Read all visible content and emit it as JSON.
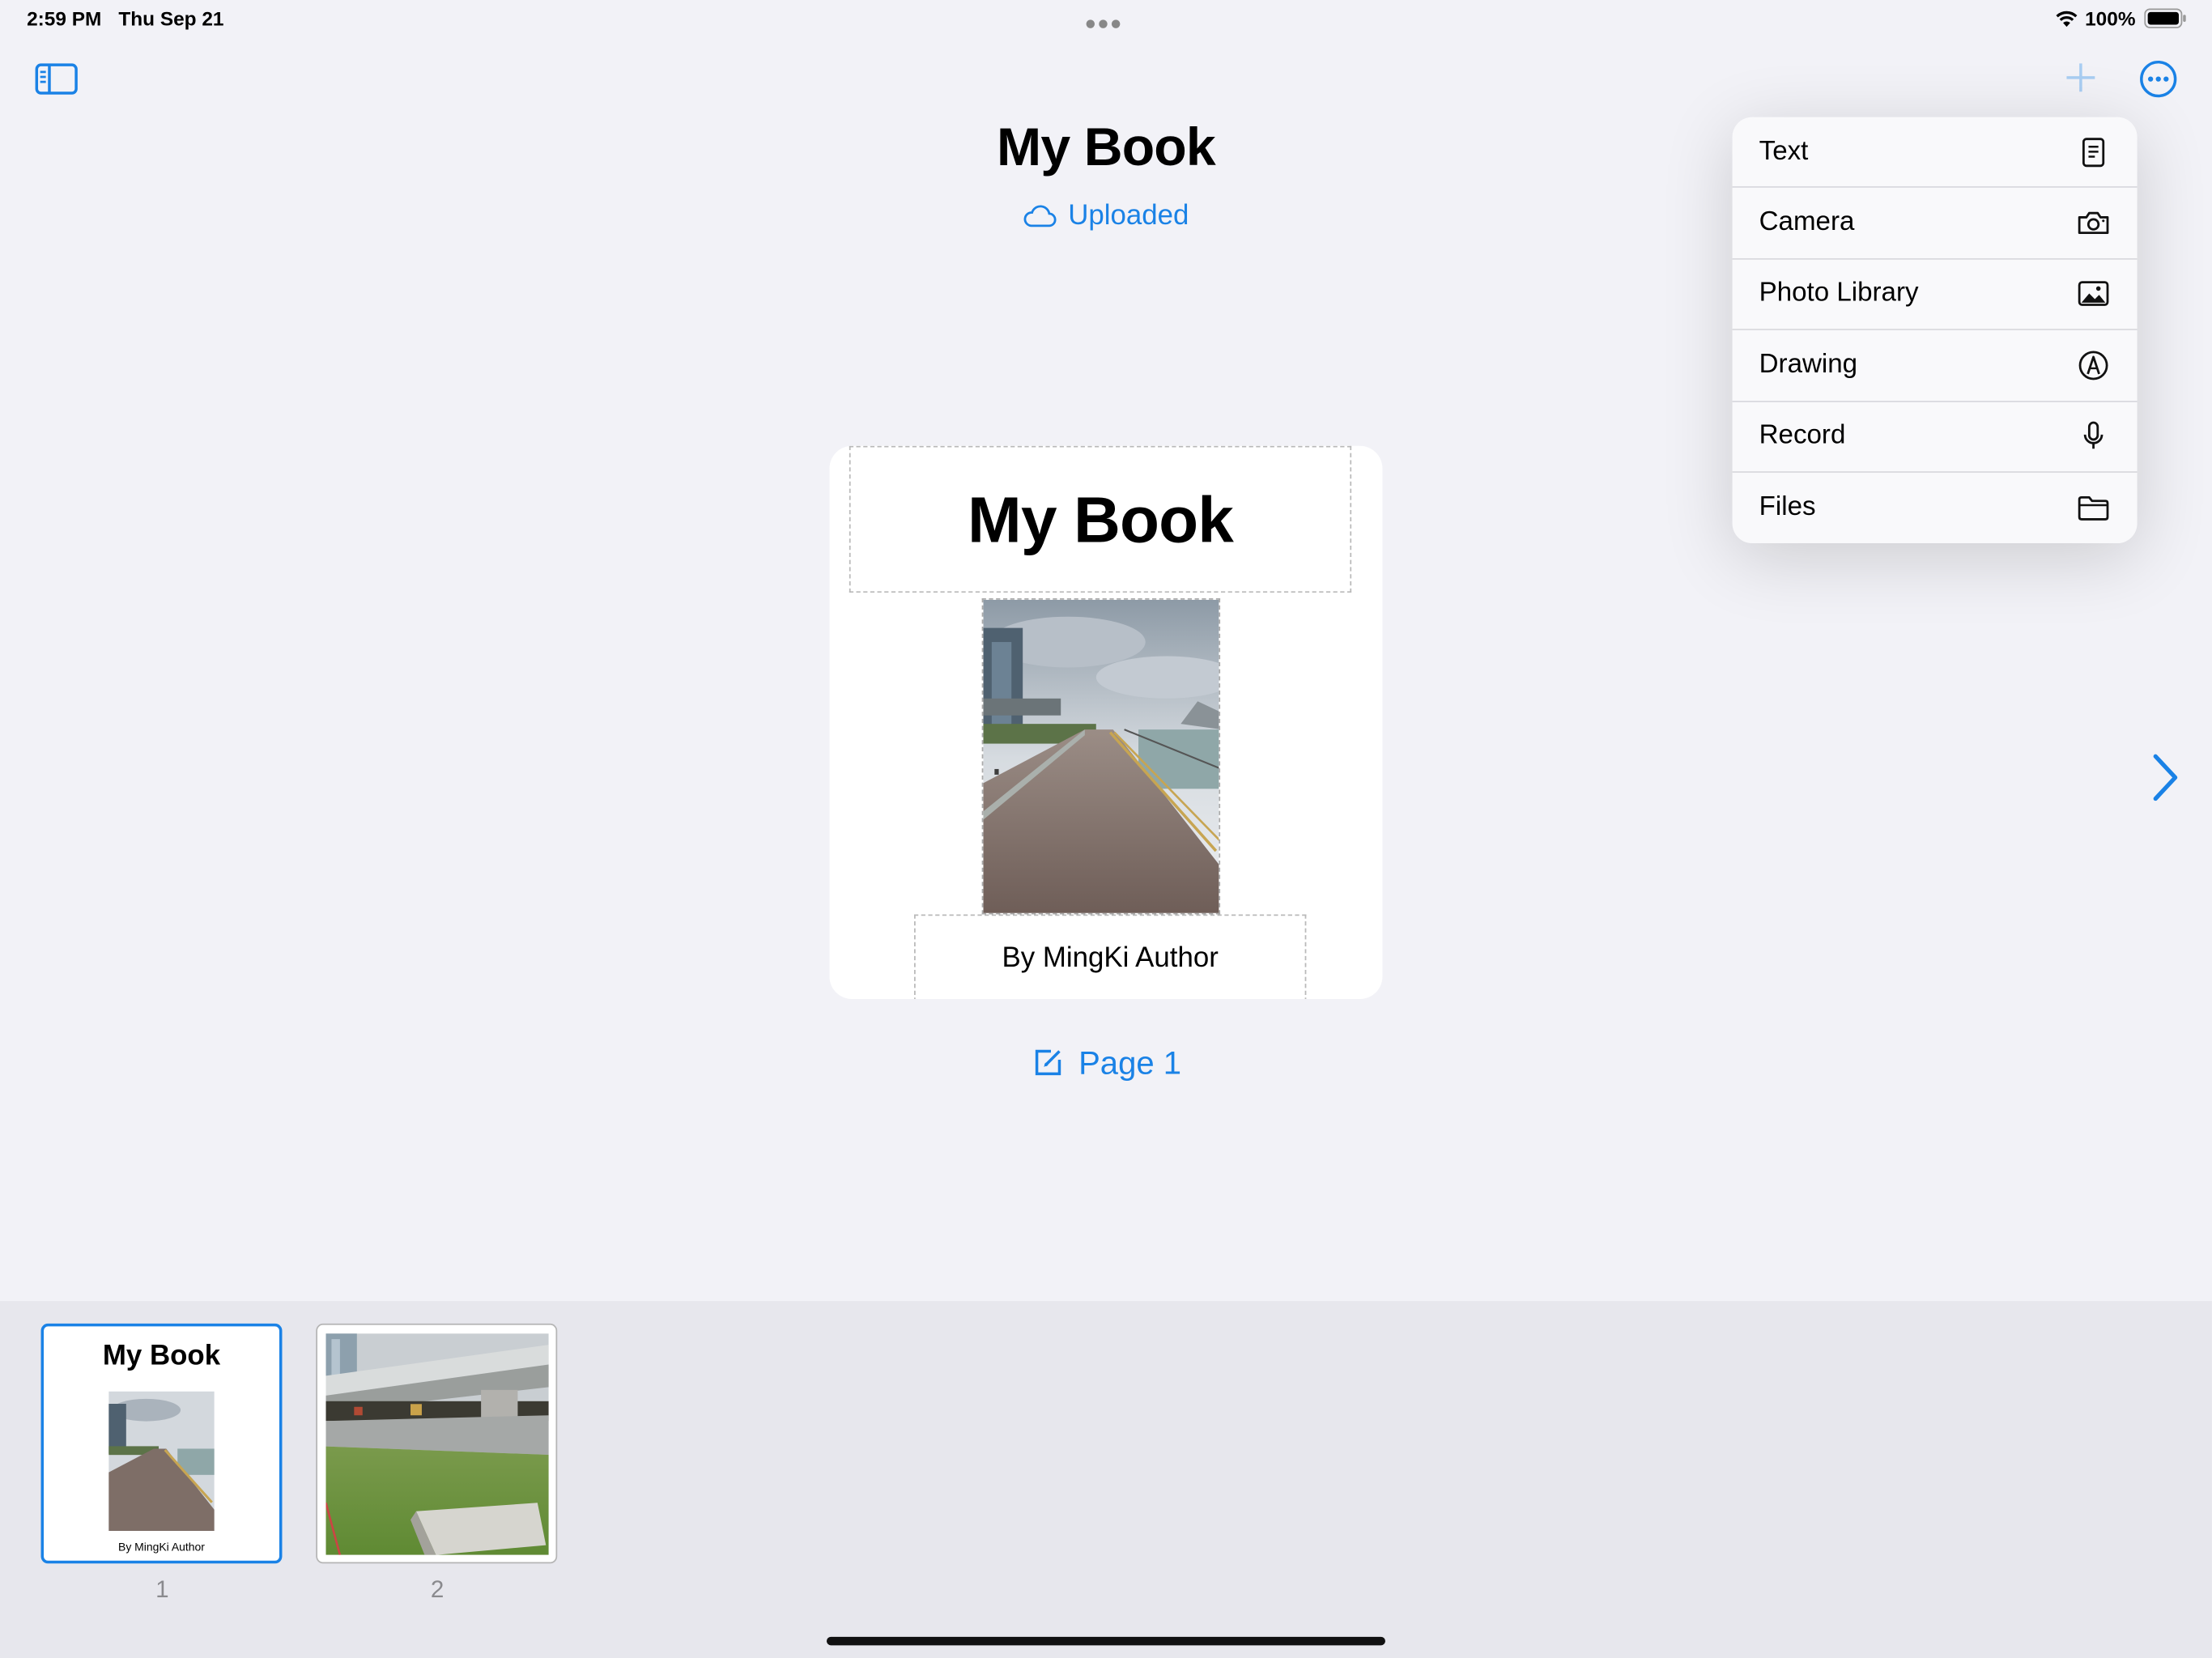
{
  "status_bar": {
    "time": "2:59 PM",
    "date": "Thu Sep 21",
    "battery": "100%"
  },
  "document": {
    "title": "My Book",
    "sync_status": "Uploaded"
  },
  "page": {
    "title": "My Book",
    "author": "By MingKi Author",
    "label": "Page 1"
  },
  "add_menu": {
    "items": [
      {
        "label": "Text",
        "icon": "text-document-icon"
      },
      {
        "label": "Camera",
        "icon": "camera-icon"
      },
      {
        "label": "Photo Library",
        "icon": "photo-icon"
      },
      {
        "label": "Drawing",
        "icon": "pencil-tip-icon"
      },
      {
        "label": "Record",
        "icon": "microphone-icon"
      },
      {
        "label": "Files",
        "icon": "folder-icon"
      }
    ]
  },
  "thumbnails": [
    {
      "number": "1",
      "title": "My Book",
      "author": "By MingKi Author",
      "selected": true
    },
    {
      "number": "2",
      "selected": false
    }
  ],
  "colors": {
    "accent": "#1a82e6",
    "background": "#f2f2f7",
    "strip": "#e7e7ed"
  }
}
